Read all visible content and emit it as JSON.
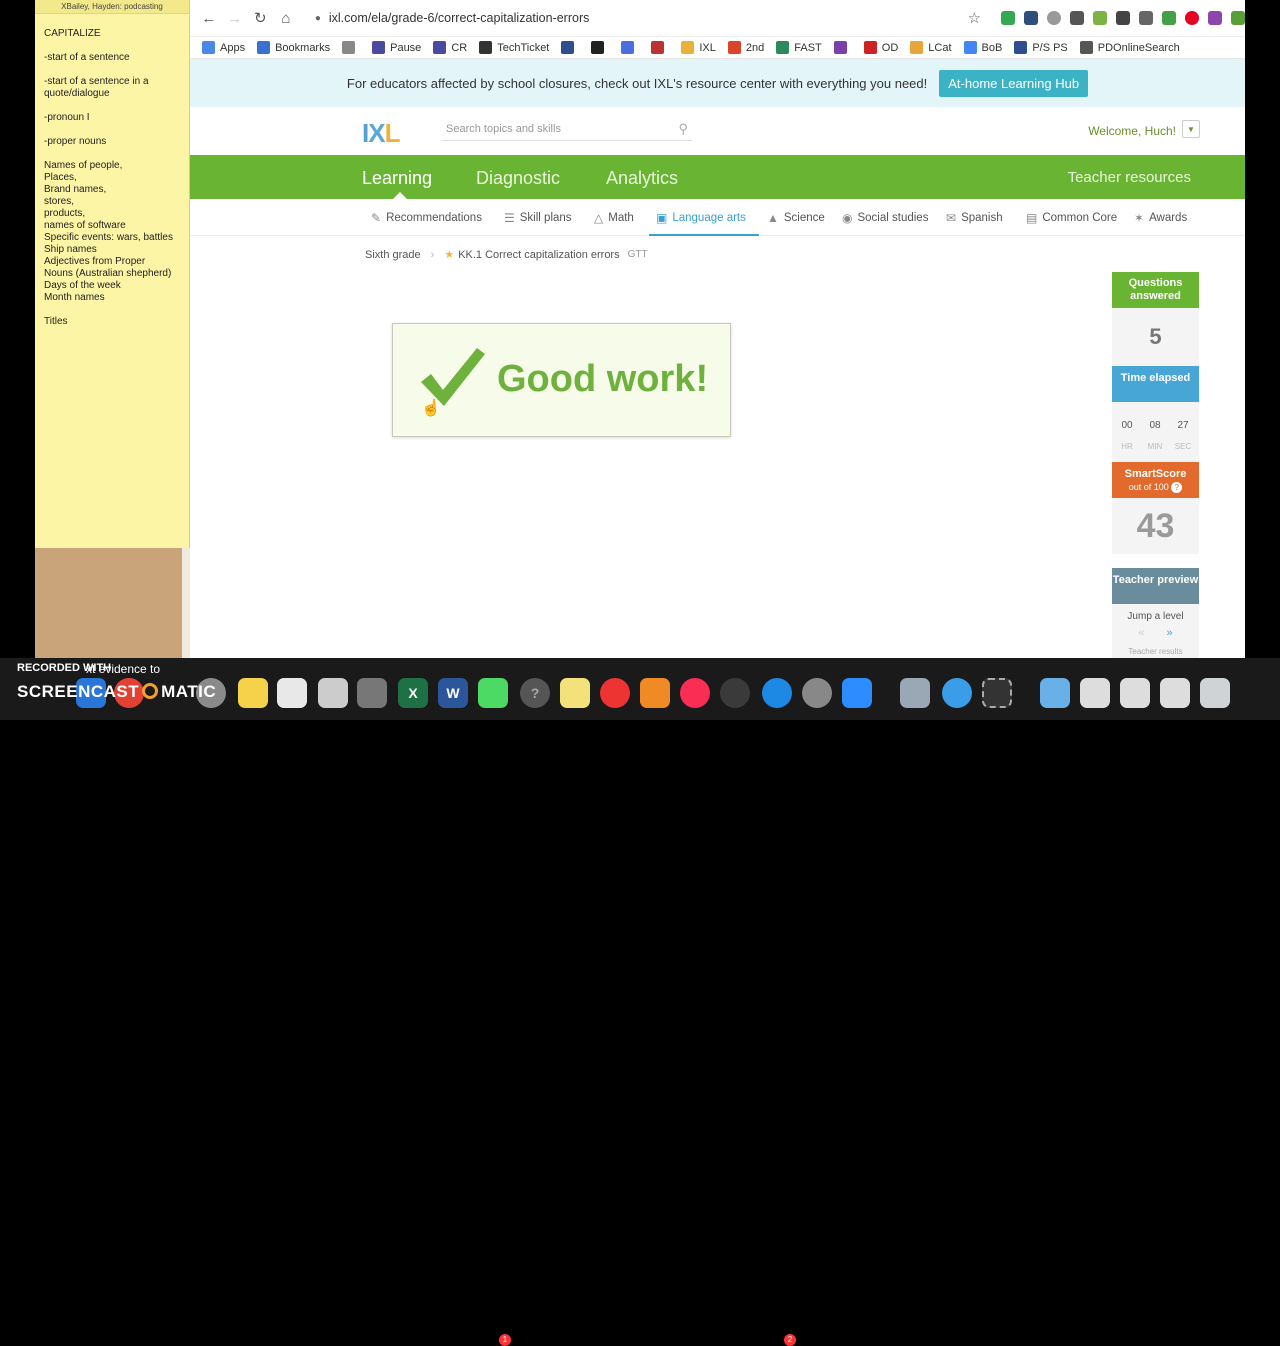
{
  "sticky": {
    "window_title": "XBailey, Hayden: podcasting",
    "heading": "CAPITALIZE",
    "lines": [
      "-start of a sentence",
      "",
      "-start of a sentence in a",
      "quote/dialogue",
      "",
      "-pronoun I",
      "",
      "-proper nouns",
      "",
      "Names of people,",
      "Places,",
      "Brand names,",
      "stores,",
      "products,",
      "names of software",
      "Specific events: wars, battles",
      "Ship names",
      "Adjectives from Proper",
      "Nouns (Australian shepherd)",
      "Days of the week",
      "Month names",
      "",
      "Titles"
    ]
  },
  "browser": {
    "url": "ixl.com/ela/grade-6/correct-capitalization-errors",
    "bookmarks": [
      {
        "label": "Apps",
        "color": "#4a88e8"
      },
      {
        "label": "Bookmarks",
        "color": "#3b6fd1"
      },
      {
        "label": "",
        "color": "#888"
      },
      {
        "label": "Pause",
        "color": "#4c4aa0"
      },
      {
        "label": "CR",
        "color": "#4c4aa0"
      },
      {
        "label": "TechTicket",
        "color": "#333"
      },
      {
        "label": "",
        "color": "#2e4e8f"
      },
      {
        "label": "",
        "color": "#222"
      },
      {
        "label": "",
        "color": "#4a6fe0"
      },
      {
        "label": "",
        "color": "#b33"
      },
      {
        "label": "IXL",
        "color": "#e8b23a"
      },
      {
        "label": "2nd",
        "color": "#d9442b"
      },
      {
        "label": "FAST",
        "color": "#2b8a5a"
      },
      {
        "label": "",
        "color": "#7a3fa8"
      },
      {
        "label": "OD",
        "color": "#c22"
      },
      {
        "label": "LCat",
        "color": "#e8a63a"
      },
      {
        "label": "BoB",
        "color": "#4285f4"
      },
      {
        "label": "P/S PS",
        "color": "#2e4e8f"
      },
      {
        "label": "PDOnlineSearch",
        "color": "#555"
      }
    ]
  },
  "banner": {
    "text": "For educators affected by school closures, check out IXL's resource center with everything you need!",
    "button": "At-home Learning Hub"
  },
  "header": {
    "logo": {
      "i": "I",
      "x": "X",
      "l": "L"
    },
    "search_placeholder": "Search topics and skills",
    "welcome": "Welcome, Huch!"
  },
  "main_nav": {
    "tabs": [
      "Learning",
      "Diagnostic",
      "Analytics"
    ],
    "teacher_resources": "Teacher resources"
  },
  "sub_nav": [
    "Recommendations",
    "Skill plans",
    "Math",
    "Language arts",
    "Science",
    "Social studies",
    "Spanish",
    "Common Core",
    "Awards"
  ],
  "breadcrumb": {
    "grade": "Sixth grade",
    "skill": "KK.1 Correct capitalization errors",
    "code": "GTT"
  },
  "feedback": {
    "text": "Good work!"
  },
  "stats": {
    "questions_answered_label": "Questions answered",
    "questions_answered": "5",
    "time_elapsed_label": "Time elapsed",
    "time": {
      "hr": "00",
      "min": "08",
      "sec": "27"
    },
    "time_units": {
      "hr": "HR",
      "min": "MIN",
      "sec": "SEC"
    },
    "smartscore_label": "SmartScore",
    "smartscore_sub": "out of 100",
    "smartscore": "43",
    "teacher_preview_label": "Teacher preview",
    "jump_level": "Jump a level",
    "teacher_results": "Teacher results"
  },
  "screencast": {
    "recorded_with": "RECORDED WITH",
    "brand": "SCREENCAST",
    "brand_suffix": "MATIC",
    "overlay": "xt evidence to"
  },
  "dock": {
    "mail_badge": "1",
    "appstore_badge": "2"
  }
}
